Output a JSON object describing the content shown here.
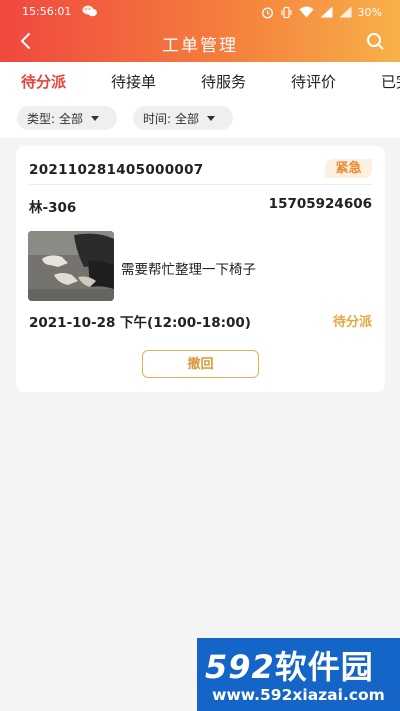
{
  "status_bar": {
    "time": "15:56:01",
    "battery": "30%"
  },
  "header": {
    "title": "工单管理"
  },
  "tabs": [
    {
      "label": "待分派",
      "active": true
    },
    {
      "label": "待接单",
      "active": false
    },
    {
      "label": "待服务",
      "active": false
    },
    {
      "label": "待评价",
      "active": false
    },
    {
      "label": "已完成",
      "active": false
    }
  ],
  "filters": {
    "type": {
      "label": "类型:",
      "value": "全部"
    },
    "time": {
      "label": "时间:",
      "value": "全部"
    }
  },
  "orders": [
    {
      "order_no": "202110281405000007",
      "priority": "紧急",
      "room": "林-306",
      "phone": "15705924606",
      "description": "需要帮忙整理一下椅子",
      "datetime": "2021-10-28 下午(12:00-18:00)",
      "status": "待分派",
      "action_label": "撤回"
    }
  ],
  "watermark": {
    "number": "592",
    "brand": "软件园",
    "url": "www.592xiazai.com"
  },
  "colors": {
    "header_start": "#f0473f",
    "header_end": "#f7b14a",
    "active_tab": "#e2463c",
    "urgent": "#ef8a2f",
    "status": "#e8a53d",
    "watermark_bg": "#1565c8"
  },
  "icons": {
    "back": "chevron-left-icon",
    "search": "search-icon",
    "wechat": "wechat-icon",
    "alarm": "alarm-icon",
    "vibrate": "vibrate-icon",
    "wifi": "wifi-icon",
    "signal": "signal-icon",
    "caret": "caret-down-icon"
  }
}
